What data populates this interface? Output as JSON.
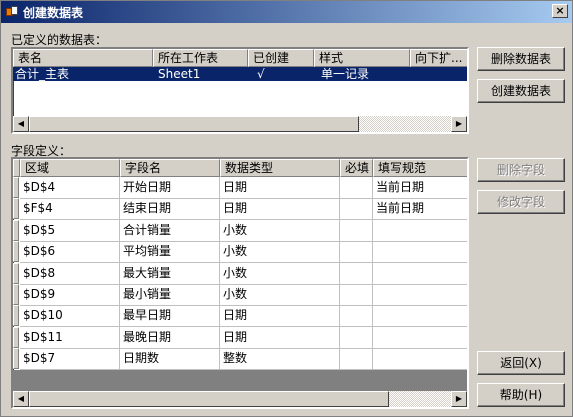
{
  "window": {
    "title": "创建数据表",
    "close": "×"
  },
  "tables_section": {
    "label": "已定义的数据表：",
    "columns": [
      "表名",
      "所在工作表",
      "已创建",
      "样式",
      "向下扩..."
    ],
    "rows": [
      {
        "name": "合计_主表",
        "sheet": "Sheet1",
        "created": "√",
        "style": "单一记录",
        "extend": ""
      }
    ]
  },
  "fields_section": {
    "label": "字段定义：",
    "columns": [
      "区域",
      "字段名",
      "数据类型",
      "必填",
      "填写规范"
    ],
    "rows": [
      {
        "range": "$D$4",
        "field": "开始日期",
        "type": "日期",
        "required": "",
        "rule": "当前日期"
      },
      {
        "range": "$F$4",
        "field": "结束日期",
        "type": "日期",
        "required": "",
        "rule": "当前日期"
      },
      {
        "range": "$D$5",
        "field": "合计销量",
        "type": "小数",
        "required": "",
        "rule": ""
      },
      {
        "range": "$D$6",
        "field": "平均销量",
        "type": "小数",
        "required": "",
        "rule": ""
      },
      {
        "range": "$D$8",
        "field": "最大销量",
        "type": "小数",
        "required": "",
        "rule": ""
      },
      {
        "range": "$D$9",
        "field": "最小销量",
        "type": "小数",
        "required": "",
        "rule": ""
      },
      {
        "range": "$D$10",
        "field": "最早日期",
        "type": "日期",
        "required": "",
        "rule": ""
      },
      {
        "range": "$D$11",
        "field": "最晚日期",
        "type": "日期",
        "required": "",
        "rule": ""
      },
      {
        "range": "$D$7",
        "field": "日期数",
        "type": "整数",
        "required": "",
        "rule": ""
      }
    ]
  },
  "buttons": {
    "delete_table": "删除数据表",
    "create_table": "创建数据表",
    "delete_field": "删除字段",
    "edit_field": "修改字段",
    "back": "返回(X)",
    "help": "帮助(H)"
  },
  "colors": {
    "selection": "#0a246a",
    "face": "#d4d0c8",
    "title_start": "#0a246a"
  }
}
